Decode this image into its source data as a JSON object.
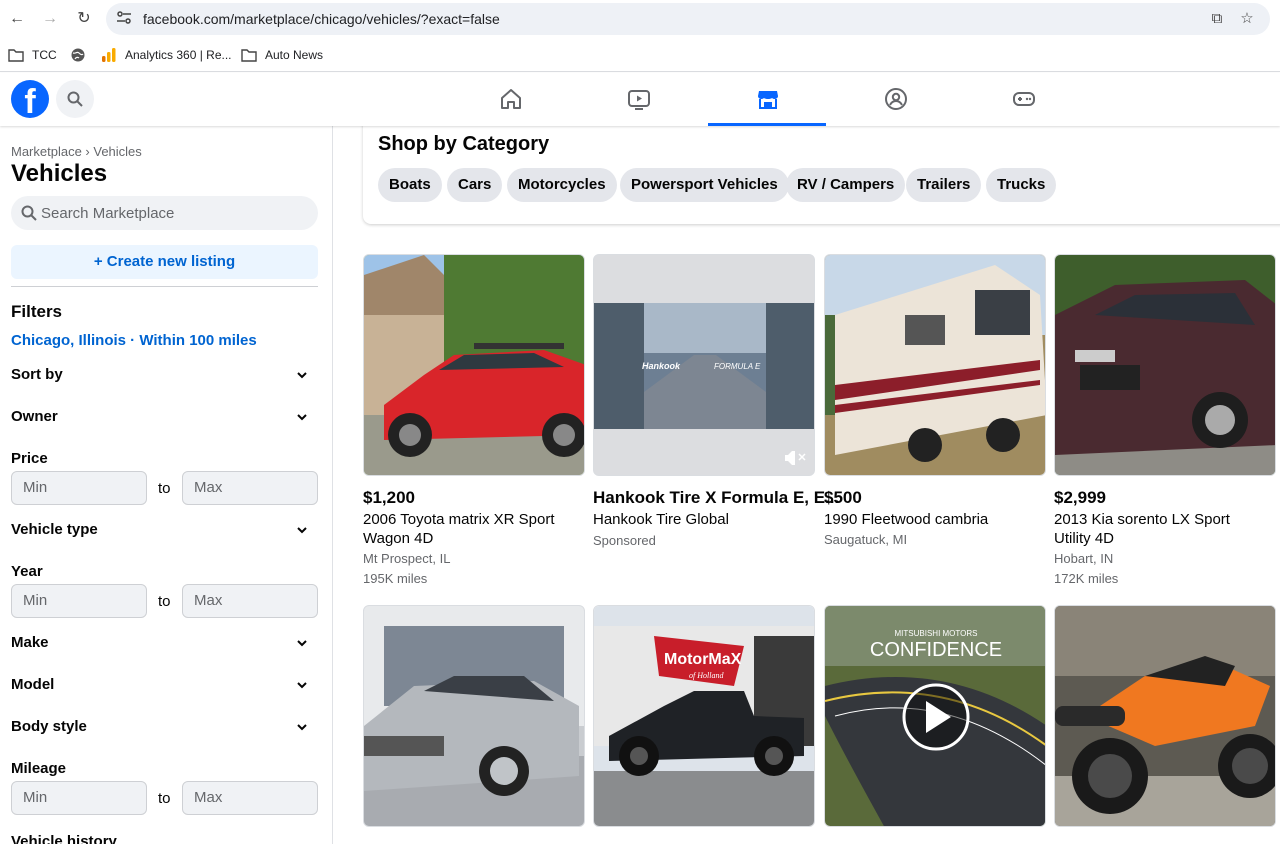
{
  "browser": {
    "url": "facebook.com/marketplace/chicago/vehicles/?exact=false",
    "bookmarks": [
      "TCC",
      "",
      "Analytics 360 | Re...",
      "Auto News"
    ]
  },
  "header": {
    "logo": "f",
    "tabs": [
      "home-icon",
      "video-icon",
      "marketplace-icon",
      "groups-icon",
      "gaming-icon"
    ],
    "active_tab": "marketplace-icon"
  },
  "sidebar": {
    "breadcrumb": "Marketplace › Vehicles",
    "title": "Vehicles",
    "search_placeholder": "Search Marketplace",
    "create_label": "+ Create new listing",
    "filters_heading": "Filters",
    "location": "Chicago, Illinois · Within 100 miles",
    "sort_by": "Sort by",
    "owner": "Owner",
    "price": "Price",
    "vehicle_type": "Vehicle type",
    "year": "Year",
    "make": "Make",
    "model": "Model",
    "body_style": "Body style",
    "mileage": "Mileage",
    "vehicle_history": "Vehicle history",
    "min_placeholder": "Min",
    "max_placeholder": "Max",
    "to": "to"
  },
  "categories": {
    "title": "Shop by Category",
    "items": [
      "Boats",
      "Cars",
      "Motorcycles",
      "Powersport Vehicles",
      "RV / Campers",
      "Trailers",
      "Trucks"
    ]
  },
  "listings": [
    {
      "price": "$1,200",
      "title": "2006 Toyota matrix XR Sport Wagon 4D",
      "location": "Mt Prospect, IL",
      "miles": "195K miles"
    },
    {
      "price": "Hankook Tire X Formula E, E...",
      "title": "Hankook Tire Global",
      "location": "Sponsored",
      "miles": "",
      "ad_text_1": "Hankook",
      "ad_text_2": "FORMULA E"
    },
    {
      "price": "$500",
      "title": "1990 Fleetwood cambria",
      "location": "Saugatuck, MI",
      "miles": ""
    },
    {
      "price": "$2,999",
      "title": "2013 Kia sorento LX Sport Utility 4D",
      "location": "Hobart, IN",
      "miles": "172K miles"
    }
  ],
  "row2_images": [
    {
      "name": "mercedes-photo"
    },
    {
      "name": "motormax-truck-photo",
      "sign": "MotorMaX",
      "sign_sub": "of Holland"
    },
    {
      "name": "mitsubishi-ad-video",
      "brand": "MITSUBISHI MOTORS",
      "headline": "CONFIDENCE"
    },
    {
      "name": "ktm-motorcycle-photo"
    }
  ]
}
